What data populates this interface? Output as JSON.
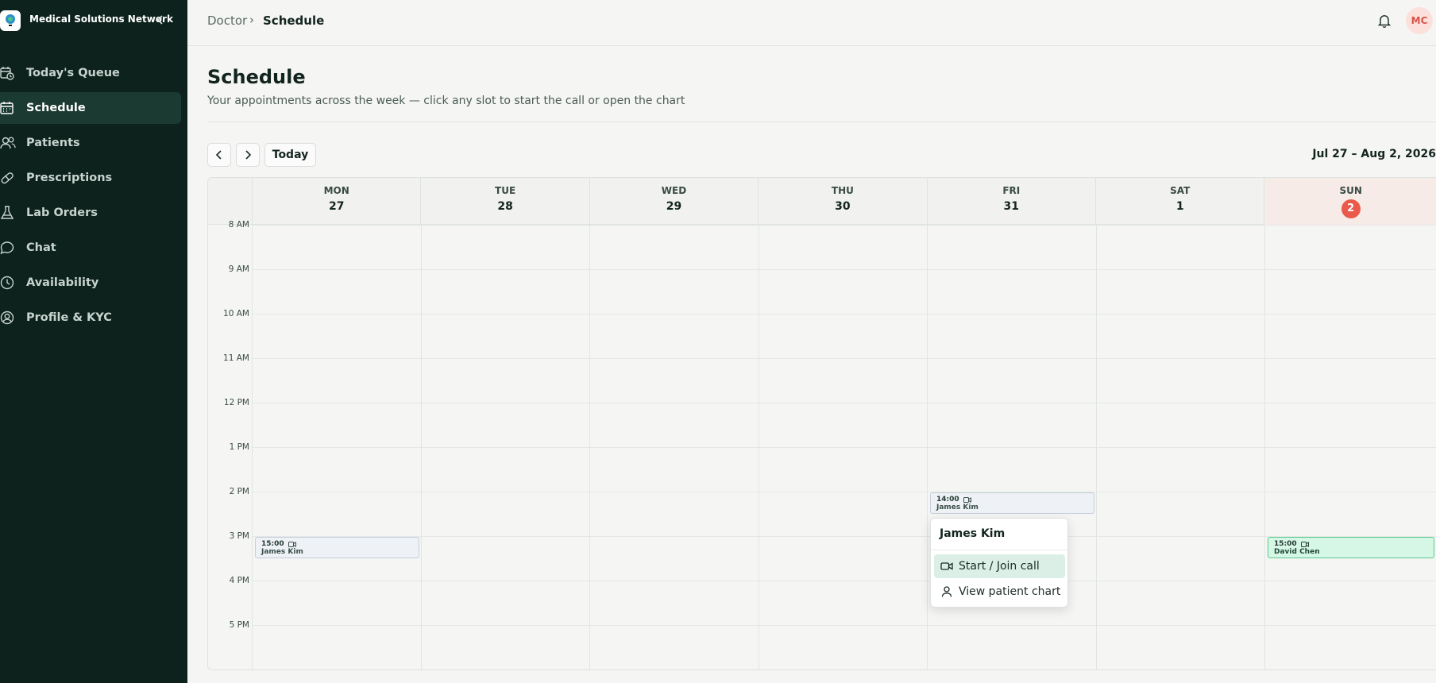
{
  "brand": {
    "name": "Medical Solutions Network"
  },
  "sidebar": {
    "items": [
      {
        "label": "Today's Queue",
        "icon": "calendar-clock-icon"
      },
      {
        "label": "Schedule",
        "icon": "calendar-icon",
        "active": true
      },
      {
        "label": "Patients",
        "icon": "users-icon"
      },
      {
        "label": "Prescriptions",
        "icon": "pill-icon"
      },
      {
        "label": "Lab Orders",
        "icon": "flask-icon"
      },
      {
        "label": "Chat",
        "icon": "chat-bubble-icon"
      },
      {
        "label": "Availability",
        "icon": "clock-icon"
      },
      {
        "label": "Profile & KYC",
        "icon": "user-circle-icon"
      }
    ]
  },
  "breadcrumb": {
    "root": "Doctor",
    "separator": "›",
    "current": "Schedule"
  },
  "user": {
    "initials": "MC"
  },
  "page": {
    "title": "Schedule",
    "subtitle": "Your appointments across the week — click any slot to start the call or open the chart"
  },
  "toolbar": {
    "today_label": "Today",
    "range": "Jul 27 – Aug 2, 2026"
  },
  "calendar": {
    "days": [
      {
        "name": "MON",
        "date": "27"
      },
      {
        "name": "TUE",
        "date": "28"
      },
      {
        "name": "WED",
        "date": "29"
      },
      {
        "name": "THU",
        "date": "30"
      },
      {
        "name": "FRI",
        "date": "31"
      },
      {
        "name": "SAT",
        "date": "1"
      },
      {
        "name": "SUN",
        "date": "2",
        "today": true
      }
    ],
    "hours": [
      "8 AM",
      "9 AM",
      "10 AM",
      "11 AM",
      "12 PM",
      "1 PM",
      "2 PM",
      "3 PM",
      "4 PM",
      "5 PM"
    ],
    "events": [
      {
        "time": "15:00",
        "patient": "James Kim",
        "day": "MON",
        "status": "scheduled"
      },
      {
        "time": "14:00",
        "patient": "James Kim",
        "day": "FRI",
        "status": "scheduled"
      },
      {
        "time": "15:00",
        "patient": "David Chen",
        "day": "SUN",
        "status": "confirmed"
      }
    ]
  },
  "popover": {
    "title": "James Kim",
    "actions": [
      {
        "label": "Start / Join call",
        "icon": "video-icon"
      },
      {
        "label": "View patient chart",
        "icon": "user-icon"
      }
    ]
  },
  "colors": {
    "sidebar_bg": "#0d221c",
    "accent_today": "#ea5a4b",
    "event_confirmed": "#d7f7e6",
    "event_scheduled": "#eef1f5"
  }
}
